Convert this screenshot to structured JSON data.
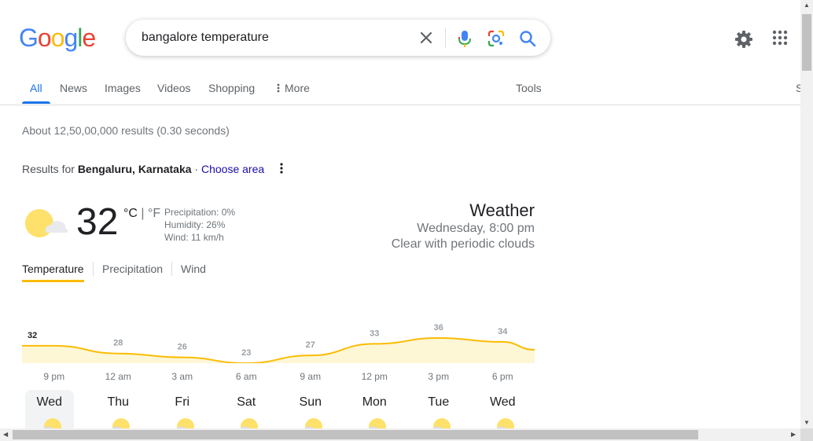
{
  "header": {
    "logo_letters": [
      {
        "ch": "G",
        "color": "#4285F4"
      },
      {
        "ch": "o",
        "color": "#EA4335"
      },
      {
        "ch": "o",
        "color": "#FBBC05"
      },
      {
        "ch": "g",
        "color": "#4285F4"
      },
      {
        "ch": "l",
        "color": "#34A853"
      },
      {
        "ch": "e",
        "color": "#EA4335"
      }
    ],
    "search_value": "bangalore temperature",
    "icons": [
      "clear-icon",
      "mic-icon",
      "lens-icon",
      "search-icon",
      "settings-icon",
      "apps-icon"
    ]
  },
  "tabs": {
    "all": "All",
    "news": "News",
    "images": "Images",
    "videos": "Videos",
    "shopping": "Shopping",
    "more": "More",
    "tools": "Tools",
    "cut_off": "S"
  },
  "stats": "About 12,50,00,000 results (0.30 seconds)",
  "location": {
    "prefix": "Results for ",
    "place": "Bengaluru, Karnataka",
    "separator": " · ",
    "link": "Choose area"
  },
  "weather": {
    "temp": "32",
    "unit_c": "°C",
    "unit_sep": " | ",
    "unit_f": "°F",
    "precipitation": "Precipitation: 0%",
    "humidity": "Humidity: 26%",
    "wind": "Wind: 11 km/h",
    "title": "Weather",
    "datetime": "Wednesday, 8:00 pm",
    "condition": "Clear with periodic clouds",
    "tabs": {
      "temperature": "Temperature",
      "precipitation": "Precipitation",
      "wind": "Wind"
    },
    "hourly": {
      "temps": [
        32,
        28,
        26,
        23,
        27,
        33,
        36,
        34
      ],
      "times": [
        "9 pm",
        "12 am",
        "3 am",
        "6 am",
        "9 am",
        "12 pm",
        "3 pm",
        "6 pm"
      ],
      "line_color": "#FBBC04",
      "fill_color": "#FEF7D6"
    },
    "days": [
      "Wed",
      "Thu",
      "Fri",
      "Sat",
      "Sun",
      "Mon",
      "Tue",
      "Wed"
    ],
    "selected_day_index": 0
  }
}
